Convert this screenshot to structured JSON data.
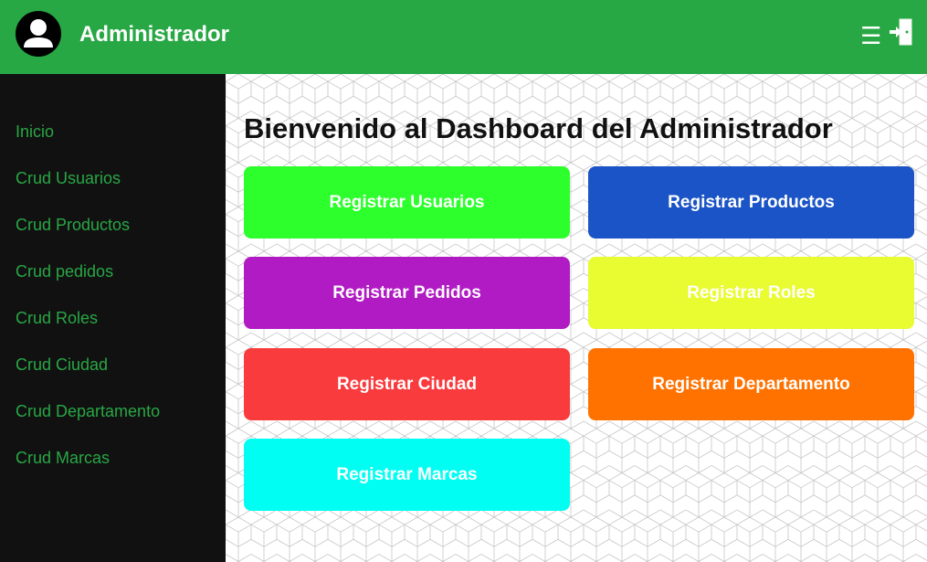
{
  "header": {
    "title": "Administrador",
    "avatar_icon": "user-avatar-icon",
    "menu_icon": "hamburger-menu-icon",
    "menu_glyph": "☰",
    "logout_icon": "logout-door-icon",
    "color": "#28a745"
  },
  "sidebar": {
    "items": [
      {
        "label": "Inicio"
      },
      {
        "label": "Crud Usuarios"
      },
      {
        "label": "Crud Productos"
      },
      {
        "label": "Crud pedidos"
      },
      {
        "label": "Crud Roles"
      },
      {
        "label": "Crud Ciudad"
      },
      {
        "label": "Crud Departamento"
      },
      {
        "label": "Crud Marcas"
      }
    ],
    "background": "#111111",
    "text_color": "#28a745"
  },
  "main": {
    "title": "Bienvenido al Dashboard del Administrador",
    "buttons": [
      {
        "label": "Registrar Usuarios",
        "color": "#2cff2c"
      },
      {
        "label": "Registrar Productos",
        "color": "#1a54c6"
      },
      {
        "label": "Registrar Pedidos",
        "color": "#b11bc4"
      },
      {
        "label": "Registrar Roles",
        "color": "#e9fb31"
      },
      {
        "label": "Registrar Ciudad",
        "color": "#fa3b3e"
      },
      {
        "label": "Registrar Departamento",
        "color": "#ff7200"
      },
      {
        "label": "Registrar Marcas",
        "color": "#00fff2"
      }
    ]
  }
}
